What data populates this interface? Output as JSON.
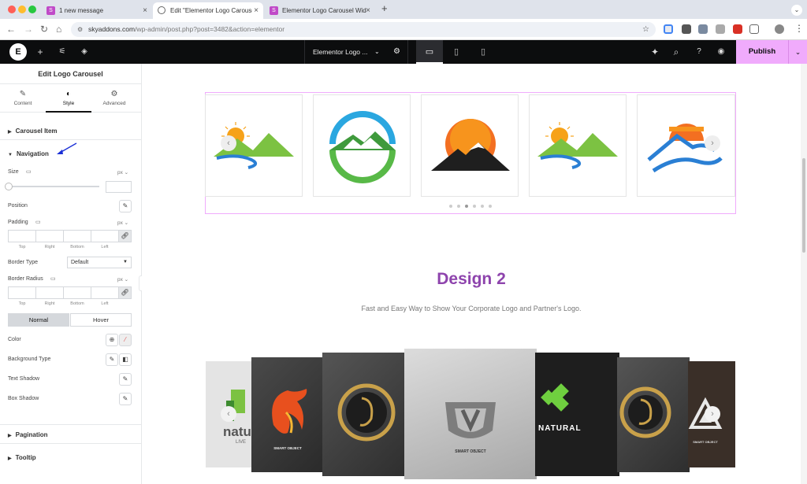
{
  "browser": {
    "tabs": [
      {
        "label": "1 new message",
        "favicon": "SA"
      },
      {
        "label": "Edit \"Elementor Logo Carousel\"",
        "favicon": "globe"
      },
      {
        "label": "Elementor Logo Carousel Wid",
        "favicon": "SA"
      }
    ],
    "new_tab": "+",
    "url_domain": "skyaddons.com",
    "url_path": "/wp-admin/post.php?post=3482&action=elementor"
  },
  "editor_topbar": {
    "page_name": "Elementor Logo ...",
    "publish_label": "Publish"
  },
  "panel": {
    "title": "Edit Logo Carousel",
    "tabs": [
      {
        "label": "Content",
        "icon": "pencil-icon"
      },
      {
        "label": "Style",
        "icon": "half-circle-icon"
      },
      {
        "label": "Advanced",
        "icon": "gear-icon"
      }
    ],
    "section_carousel_item": "Carousel Item",
    "section_navigation": "Navigation",
    "size_label": "Size",
    "unit_px": "px",
    "position_label": "Position",
    "padding_label": "Padding",
    "sides": [
      "Top",
      "Right",
      "Bottom",
      "Left"
    ],
    "border_type_label": "Border Type",
    "border_type_value": "Default",
    "border_radius_label": "Border Radius",
    "toggle_normal": "Normal",
    "toggle_hover": "Hover",
    "color_label": "Color",
    "background_type_label": "Background Type",
    "text_shadow_label": "Text Shadow",
    "box_shadow_label": "Box Shadow",
    "section_pagination": "Pagination",
    "section_tooltip": "Tooltip"
  },
  "canvas": {
    "design2_title": "Design 2",
    "design2_subtitle": "Fast and Easy Way to Show Your Corporate Logo and Partner's Logo.",
    "pagination_dots": 6,
    "active_dot": 3,
    "card_texts": {
      "natural_left": "natu",
      "natural_left_sub": "LIVE",
      "smart_object": "SMART OBJECT",
      "natural": "NATURAL"
    }
  },
  "colors": {
    "accent_pink": "#f0abfc",
    "heading_purple": "#8e44ad",
    "editor_bar": "#0c0d0e"
  }
}
